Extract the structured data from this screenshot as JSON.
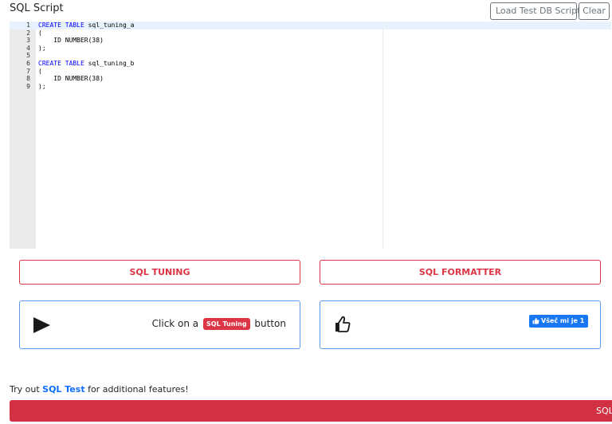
{
  "header": {
    "title": "SQL Script",
    "load_button": "Load Test DB Script",
    "clear_button": "Clear"
  },
  "editor": {
    "lines": [
      {
        "num": "1",
        "kw": "CREATE TABLE",
        "rest": " sql_tuning_a"
      },
      {
        "num": "2",
        "kw": "",
        "rest": "("
      },
      {
        "num": "3",
        "kw": "",
        "rest": "    ID NUMBER(38)"
      },
      {
        "num": "4",
        "kw": "",
        "rest": ");"
      },
      {
        "num": "5",
        "kw": "",
        "rest": ""
      },
      {
        "num": "6",
        "kw": "CREATE TABLE",
        "rest": " sql_tuning_b"
      },
      {
        "num": "7",
        "kw": "",
        "rest": "("
      },
      {
        "num": "8",
        "kw": "",
        "rest": "    ID NUMBER(38)"
      },
      {
        "num": "9",
        "kw": "",
        "rest": ");"
      }
    ]
  },
  "actions": {
    "tuning_button": "SQL TUNING",
    "formatter_button": "SQL FORMATTER"
  },
  "result_card": {
    "icon": "play-icon",
    "text_before": "Click on a",
    "badge": "SQL Tuning",
    "text_after": "button"
  },
  "like_card": {
    "icon": "thumbs-up-icon",
    "fb_like_label": "Všeč mi je 1"
  },
  "promo": {
    "prefix": "Try out",
    "link": "SQL Test",
    "suffix": "for additional features!"
  },
  "bottom_bar": {
    "label": "SQL"
  },
  "colors": {
    "accent_red": "#dc3545",
    "card_border_blue": "#5b9bf0",
    "link_blue": "#0d6efd",
    "facebook_blue": "#1877f2"
  }
}
